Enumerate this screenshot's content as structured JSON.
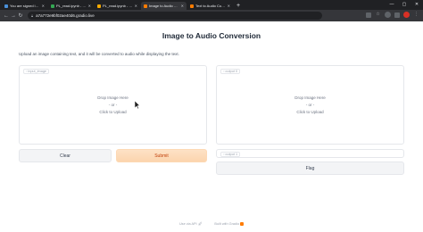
{
  "browser": {
    "tabs": [
      {
        "title": "You are signed in as 22msc...",
        "color": "#4a90d9",
        "active": false
      },
      {
        "title": "PL_read.ipynb - Google Dri...",
        "color": "#34a853",
        "active": false
      },
      {
        "title": "PL_read.ipynb - Colaborato...",
        "color": "#f9ab00",
        "active": false
      },
      {
        "title": "Image to Audio Conversion",
        "color": "#ff7c00",
        "active": true
      },
      {
        "title": "Text to Audio Conversion",
        "color": "#ff7c00",
        "active": false
      }
    ],
    "new_tab": "+",
    "url": "a7a772e9bf02ae40d6.gradio.live",
    "min": "—",
    "max": "▢",
    "close": "✕"
  },
  "app": {
    "title": "Image to Audio Conversion",
    "description": "Upload an image containing text, and it will be converted to audio while displaying the text.",
    "input_label": "input_image",
    "drop_text": "Drop Image Here",
    "or_text": "- or -",
    "click_text": "Click to Upload",
    "clear_label": "Clear",
    "submit_label": "Submit",
    "output0_label": "output 0",
    "output1_label": "output 1",
    "flag_label": "Flag"
  },
  "footer": {
    "api": "Use via API",
    "built": "Built with Gradio"
  }
}
